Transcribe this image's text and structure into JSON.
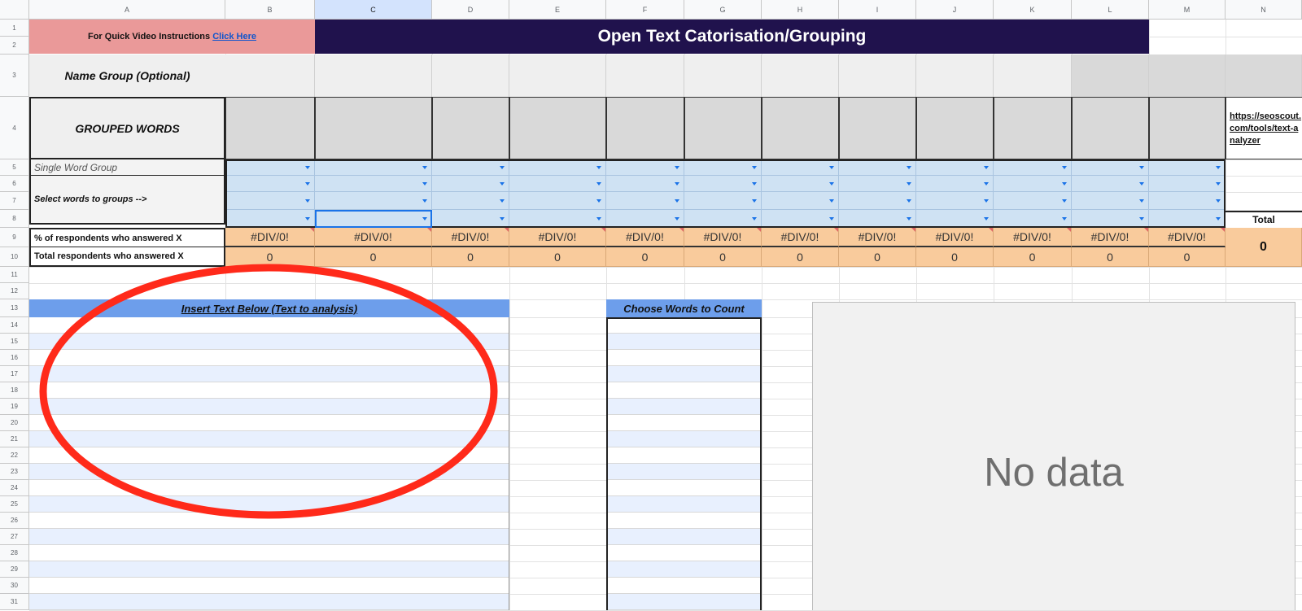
{
  "columns": [
    "A",
    "B",
    "C",
    "D",
    "E",
    "F",
    "G",
    "H",
    "I",
    "J",
    "K",
    "L",
    "M",
    "N"
  ],
  "selected_column": "C",
  "rows": [
    "1",
    "2",
    "3",
    "4",
    "5",
    "6",
    "7",
    "8",
    "9",
    "10",
    "11",
    "12",
    "13",
    "14",
    "15",
    "16",
    "17",
    "18",
    "19",
    "20",
    "21",
    "22",
    "23",
    "24",
    "25",
    "26",
    "27",
    "28",
    "29",
    "30",
    "31"
  ],
  "header": {
    "instructions_prefix": "For Quick Video Instructions",
    "instructions_link": "Click Here",
    "title": "Open Text Catorisation/Grouping"
  },
  "labels": {
    "name_group": "Name Group (Optional)",
    "grouped_words": "GROUPED WORDS",
    "single_word_group": "Single Word Group",
    "select_words": "Select words to groups -->",
    "pct_respondents": "% of respondents who answered X",
    "total_respondents": "Total respondents who answered X"
  },
  "side": {
    "url": "https://seoscout.com/tools/text-analyzer",
    "total_label": "Total",
    "total_value": "0"
  },
  "pct_values": [
    "#DIV/0!",
    "#DIV/0!",
    "#DIV/0!",
    "#DIV/0!",
    "#DIV/0!",
    "#DIV/0!",
    "#DIV/0!",
    "#DIV/0!",
    "#DIV/0!",
    "#DIV/0!",
    "#DIV/0!",
    "#DIV/0!"
  ],
  "total_values": [
    "0",
    "0",
    "0",
    "0",
    "0",
    "0",
    "0",
    "0",
    "0",
    "0",
    "0",
    "0"
  ],
  "insert_text_header": "Insert Text Below (Text to analysis)",
  "choose_words_header": "Choose Words to Count",
  "chart_placeholder": "No data",
  "colors": {
    "header_pink": "#ea9999",
    "title_navy": "#20124d",
    "blue_header": "#6d9eeb",
    "dropdown_blue": "#cfe2f3",
    "orange": "#f9cb9c",
    "stripe": "#e8f0fe",
    "annotation_red": "#ff2a1a"
  }
}
